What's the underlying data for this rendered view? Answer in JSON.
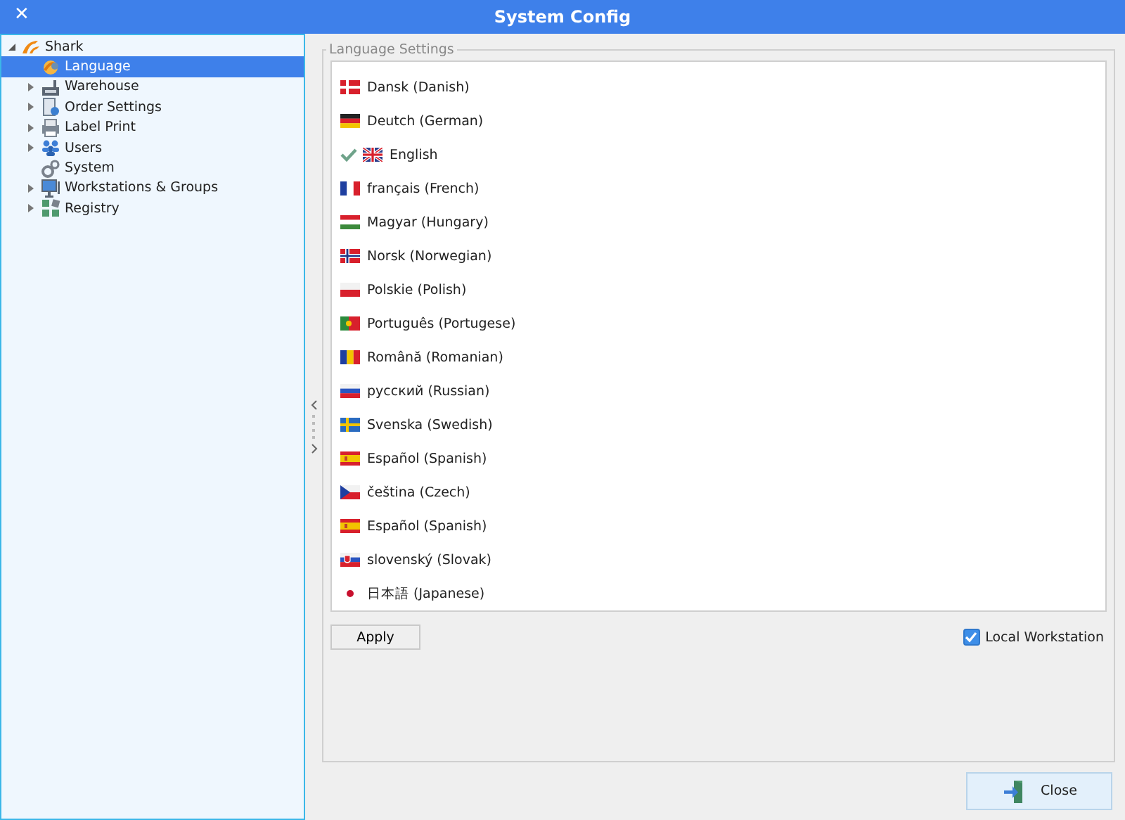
{
  "window": {
    "title": "System Config",
    "close": "✕"
  },
  "tree": {
    "label": "Shark",
    "expanded": true,
    "children": [
      {
        "label": "Language",
        "kind": "globe",
        "expandable": false,
        "selected": true
      },
      {
        "label": "Warehouse",
        "kind": "factory",
        "expandable": true,
        "selected": false
      },
      {
        "label": "Order Settings",
        "kind": "document",
        "expandable": true,
        "selected": false
      },
      {
        "label": "Label Print",
        "kind": "printer",
        "expandable": true,
        "selected": false
      },
      {
        "label": "Users",
        "kind": "users",
        "expandable": true,
        "selected": false
      },
      {
        "label": "System",
        "kind": "gears",
        "expandable": false,
        "selected": false
      },
      {
        "label": "Workstations & Groups",
        "kind": "monitor",
        "expandable": true,
        "selected": false
      },
      {
        "label": "Registry",
        "kind": "blocks",
        "expandable": true,
        "selected": false
      }
    ]
  },
  "language_settings": {
    "title": "Language Settings",
    "languages": [
      {
        "label": "Dansk (Danish)",
        "kind": "dk",
        "selected": false
      },
      {
        "label": "Deutch (German)",
        "kind": "de",
        "selected": false
      },
      {
        "label": "English",
        "kind": "gb",
        "selected": true
      },
      {
        "label": "français (French)",
        "kind": "fr",
        "selected": false
      },
      {
        "label": "Magyar (Hungary)",
        "kind": "hu",
        "selected": false
      },
      {
        "label": "Norsk (Norwegian)",
        "kind": "no",
        "selected": false
      },
      {
        "label": "Polskie (Polish)",
        "kind": "pl",
        "selected": false
      },
      {
        "label": "Português (Portugese)",
        "kind": "pt",
        "selected": false
      },
      {
        "label": "Română (Romanian)",
        "kind": "ro",
        "selected": false
      },
      {
        "label": "русский (Russian)",
        "kind": "ru",
        "selected": false
      },
      {
        "label": "Svenska (Swedish)",
        "kind": "se",
        "selected": false
      },
      {
        "label": "Español (Spanish)",
        "kind": "es",
        "selected": false
      },
      {
        "label": "čeština (Czech)",
        "kind": "cz",
        "selected": false
      },
      {
        "label": "Español (Spanish)",
        "kind": "es",
        "selected": false
      },
      {
        "label": "slovenský (Slovak)",
        "kind": "sk",
        "selected": false
      },
      {
        "label": "日本語 (Japanese)",
        "kind": "jp",
        "selected": false
      }
    ],
    "apply_button": "Apply",
    "local_workstation": {
      "label": "Local Workstation",
      "checked": true
    }
  },
  "close_button": "Close"
}
